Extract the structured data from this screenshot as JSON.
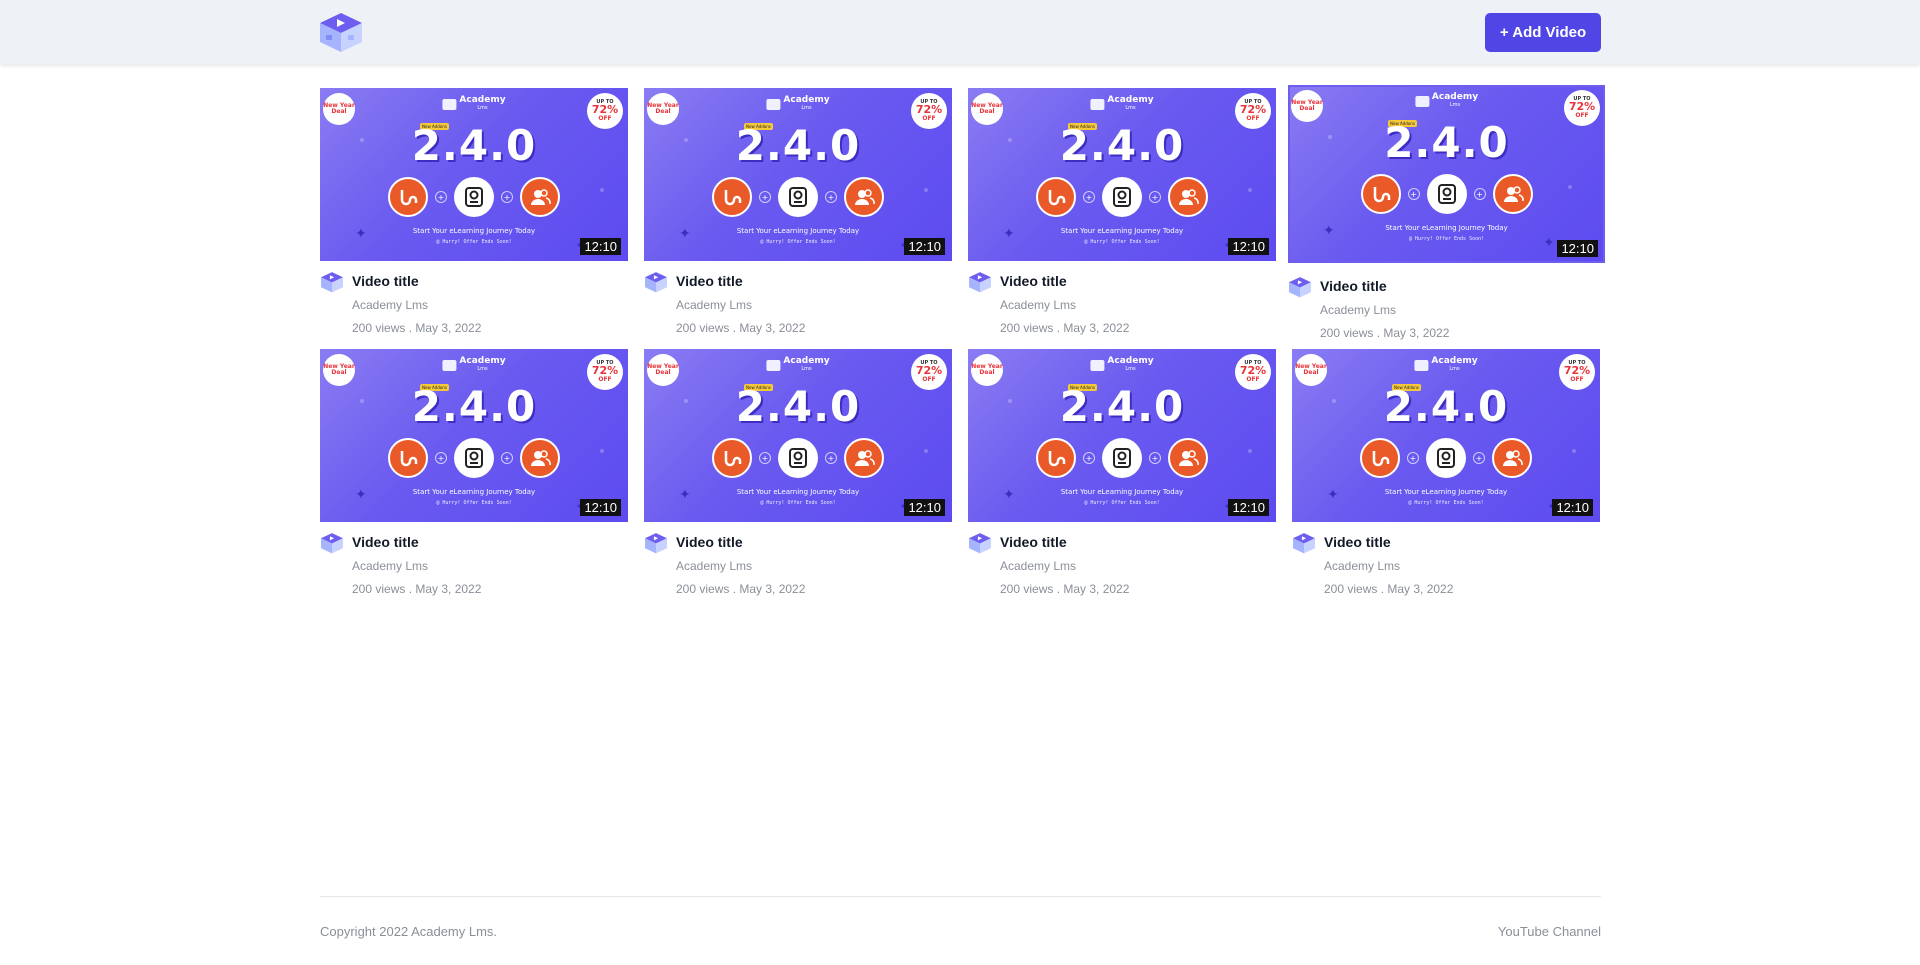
{
  "header": {
    "logo_icon": "academy-logo-icon",
    "add_video_label": "+ Add Video",
    "accent_color": "#4f46e5"
  },
  "thumbnail": {
    "brand_name": "Academy",
    "brand_sub": "Lms",
    "new_tag": "New Addons",
    "new_badge": "New Year Deal",
    "off_badge_top": "UP TO",
    "off_badge_pct": "72%",
    "off_badge_bottom": "OFF",
    "version": "2.4.0",
    "tagline": "Start Your eLearning Journey Today",
    "tagline2": "@ Hurry! Offer Ends Soon!"
  },
  "videos": [
    {
      "title": "Video title",
      "channel": "Academy Lms",
      "stats": "200 views . May 3, 2022",
      "duration": "12:10"
    },
    {
      "title": "Video title",
      "channel": "Academy Lms",
      "stats": "200 views . May 3, 2022",
      "duration": "12:10"
    },
    {
      "title": "Video title",
      "channel": "Academy Lms",
      "stats": "200 views . May 3, 2022",
      "duration": "12:10"
    },
    {
      "title": "Video title",
      "channel": "Academy Lms",
      "stats": "200 views . May 3, 2022",
      "duration": "12:10",
      "hovered": true
    },
    {
      "title": "Video title",
      "channel": "Academy Lms",
      "stats": "200 views . May 3, 2022",
      "duration": "12:10"
    },
    {
      "title": "Video title",
      "channel": "Academy Lms",
      "stats": "200 views . May 3, 2022",
      "duration": "12:10"
    },
    {
      "title": "Video title",
      "channel": "Academy Lms",
      "stats": "200 views . May 3, 2022",
      "duration": "12:10"
    },
    {
      "title": "Video title",
      "channel": "Academy Lms",
      "stats": "200 views . May 3, 2022",
      "duration": "12:10"
    }
  ],
  "footer": {
    "copyright": "Copyright 2022 Academy Lms.",
    "youtube_link": "YouTube Channel"
  }
}
